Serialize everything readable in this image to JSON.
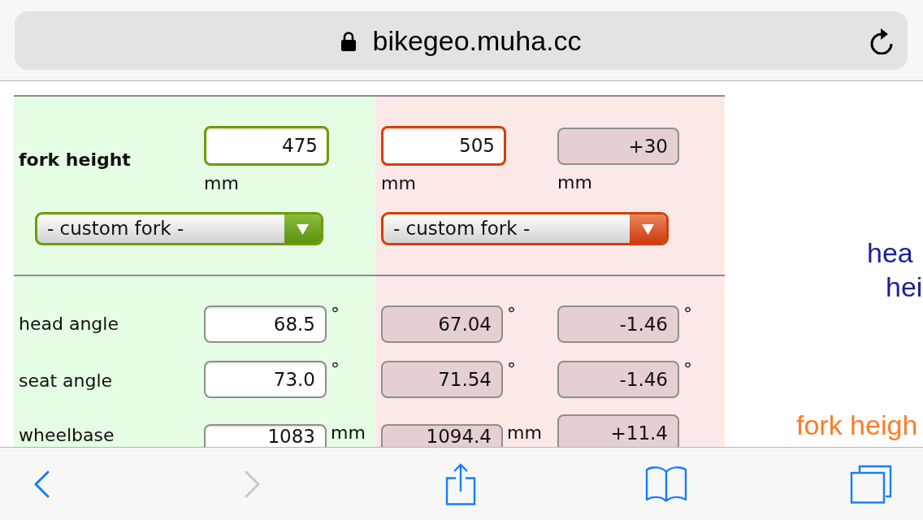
{
  "address_bar": {
    "url": "bikegeo.muha.cc",
    "secure": true
  },
  "form": {
    "fork": {
      "label": "fork height",
      "fields": [
        {
          "value": "475",
          "unit": "mm",
          "readonly": false
        },
        {
          "value": "505",
          "unit": "mm",
          "readonly": false
        },
        {
          "value": "+30",
          "unit": "mm",
          "readonly": true
        }
      ],
      "selects": [
        "- custom fork -",
        "- custom fork -"
      ]
    },
    "rows": [
      {
        "label": "head angle",
        "fields": [
          {
            "value": "68.5",
            "unit": "°",
            "readonly": false
          },
          {
            "value": "67.04",
            "unit": "°",
            "readonly": true
          },
          {
            "value": "-1.46",
            "unit": "°",
            "readonly": true
          }
        ]
      },
      {
        "label": "seat angle",
        "fields": [
          {
            "value": "73.0",
            "unit": "°",
            "readonly": false
          },
          {
            "value": "71.54",
            "unit": "°",
            "readonly": true
          },
          {
            "value": "-1.46",
            "unit": "°",
            "readonly": true
          }
        ]
      },
      {
        "label": "wheelbase",
        "fields": [
          {
            "value": "1083",
            "unit": "mm",
            "readonly": false
          },
          {
            "value": "1094.4",
            "unit": "mm",
            "readonly": true
          },
          {
            "value": "+11.4",
            "readonly": true
          }
        ]
      }
    ]
  },
  "diagram": {
    "labels": [
      {
        "text": "hea",
        "color": "#1e1e9b"
      },
      {
        "text": "hei",
        "color": "#1e1e9b"
      },
      {
        "text": "fork heigh",
        "color": "#ff7b25"
      }
    ]
  },
  "toolbar": {
    "buttons": [
      {
        "kind": "back",
        "disabled": false
      },
      {
        "kind": "forward",
        "disabled": true
      },
      {
        "kind": "share",
        "disabled": false
      },
      {
        "kind": "bookmarks",
        "disabled": false
      },
      {
        "kind": "tabs",
        "disabled": false
      }
    ]
  }
}
